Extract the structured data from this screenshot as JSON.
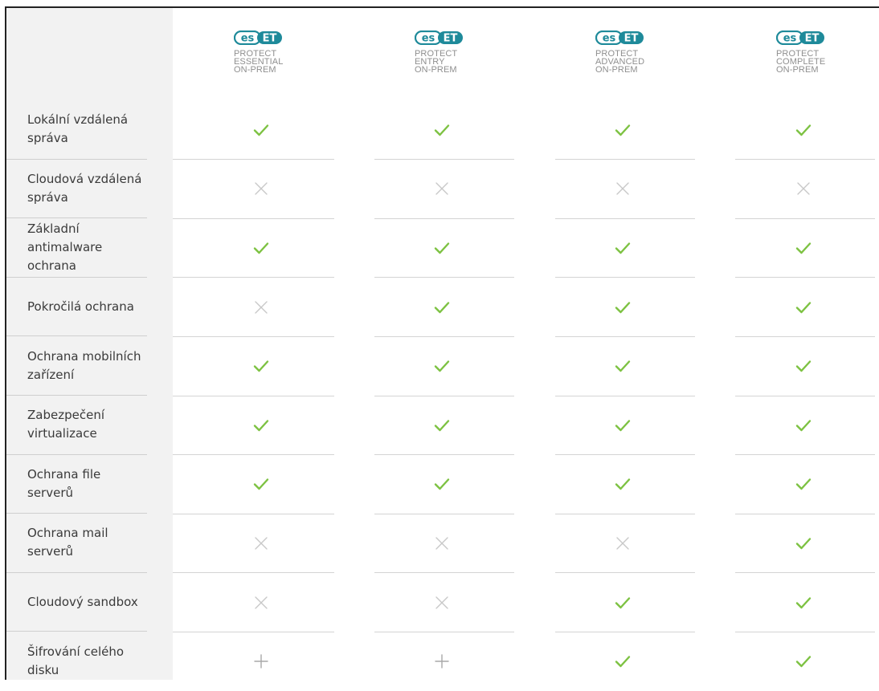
{
  "plans": [
    {
      "brand": "eset",
      "name_lines": [
        "PROTECT",
        "ESSENTIAL",
        "ON-PREM"
      ]
    },
    {
      "brand": "eset",
      "name_lines": [
        "PROTECT",
        "ENTRY",
        "ON-PREM"
      ]
    },
    {
      "brand": "eset",
      "name_lines": [
        "PROTECT",
        "ADVANCED",
        "ON-PREM"
      ]
    },
    {
      "brand": "eset",
      "name_lines": [
        "PROTECT",
        "COMPLETE",
        "ON-PREM"
      ]
    }
  ],
  "rows": [
    {
      "label": "Lokální vzdálená správa",
      "values": [
        "check",
        "check",
        "check",
        "check"
      ]
    },
    {
      "label": "Cloudová vzdálená správa",
      "values": [
        "cross",
        "cross",
        "cross",
        "cross"
      ]
    },
    {
      "label": "Základní antimalware ochrana",
      "values": [
        "check",
        "check",
        "check",
        "check"
      ]
    },
    {
      "label": "Pokročilá ochrana",
      "values": [
        "cross",
        "check",
        "check",
        "check"
      ]
    },
    {
      "label": "Ochrana mobilních zařízení",
      "values": [
        "check",
        "check",
        "check",
        "check"
      ]
    },
    {
      "label": "Zabezpečení virtualizace",
      "values": [
        "check",
        "check",
        "check",
        "check"
      ]
    },
    {
      "label": "Ochrana file serverů",
      "values": [
        "check",
        "check",
        "check",
        "check"
      ]
    },
    {
      "label": "Ochrana mail serverů",
      "values": [
        "cross",
        "cross",
        "cross",
        "check"
      ]
    },
    {
      "label": "Cloudový sandbox",
      "values": [
        "cross",
        "cross",
        "check",
        "check"
      ]
    },
    {
      "label": "Šifrování celého disku",
      "values": [
        "plus",
        "plus",
        "check",
        "check"
      ]
    }
  ],
  "colors": {
    "check": "#7dc242",
    "cross": "#c8c8c8",
    "plus": "#a8a8a8",
    "brand": "#1e8a9a",
    "feature_bg": "#f2f2f2",
    "divider": "#d4d4d4",
    "label_text": "#3a3a3a",
    "plan_text": "#8f8f8f"
  }
}
